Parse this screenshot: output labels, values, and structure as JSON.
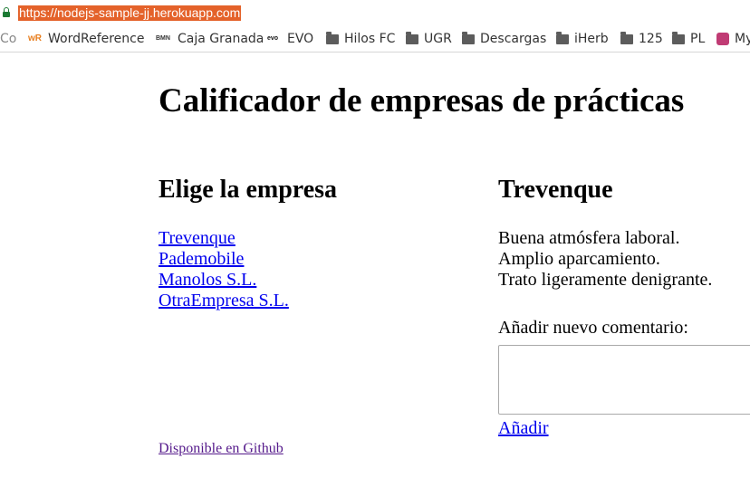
{
  "browser": {
    "url": "https://nodejs-sample-jj.herokuapp.com",
    "bookmarks": [
      {
        "label": "Co",
        "icon": "none"
      },
      {
        "label": "WordReference",
        "icon": "wordreference-icon"
      },
      {
        "label": "Caja Granada",
        "icon": "bmn-icon"
      },
      {
        "label": "EVO",
        "icon": "evo-icon"
      },
      {
        "label": "Hilos FC",
        "icon": "folder-icon"
      },
      {
        "label": "UGR",
        "icon": "folder-icon"
      },
      {
        "label": "Descargas",
        "icon": "folder-icon"
      },
      {
        "label": "iHerb",
        "icon": "folder-icon"
      },
      {
        "label": "125",
        "icon": "folder-icon"
      },
      {
        "label": "PL",
        "icon": "folder-icon"
      },
      {
        "label": "My",
        "icon": "my-icon"
      }
    ],
    "icon_text": {
      "wordreference": "wR",
      "bmn": "BMN",
      "evo": "evo"
    },
    "colors": {
      "url_highlight": "#e4622a",
      "lock": "#1b7a33",
      "link": "#0000ee",
      "visited_link": "#551a8b"
    }
  },
  "page": {
    "title": "Calificador de empresas de prácticas",
    "companies_heading": "Elige la empresa",
    "companies": [
      "Trevenque",
      "Pademobile",
      "Manolos S.L.",
      "OtraEmpresa S.L."
    ],
    "selected_company": "Trevenque",
    "comments": [
      "Buena atmósfera laboral.",
      "Amplio aparcamiento.",
      "Trato ligeramente denigrante."
    ],
    "new_comment_label": "Añadir nuevo comentario:",
    "new_comment_value": "",
    "add_link": "Añadir",
    "github_link": "Disponible en Github"
  }
}
